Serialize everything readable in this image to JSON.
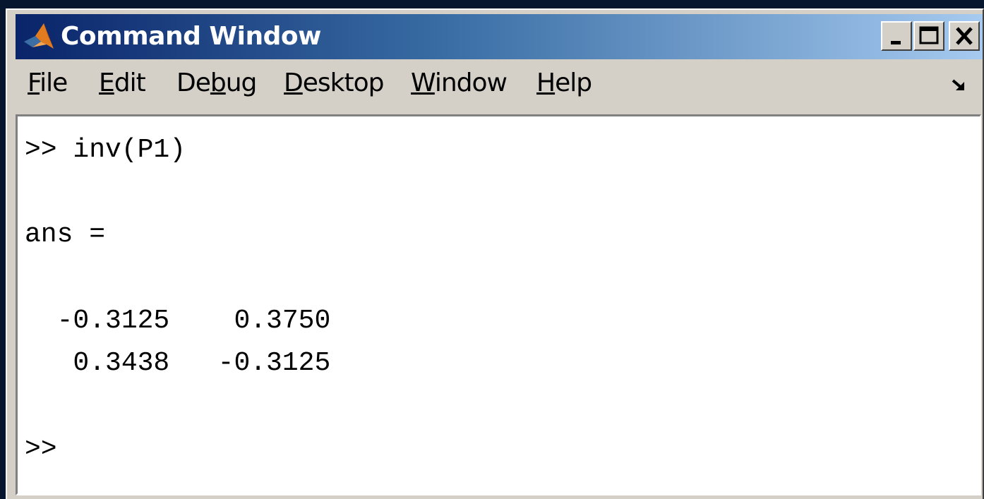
{
  "window": {
    "title": "Command Window",
    "controls": {
      "minimize": "minimize-icon",
      "maximize": "maximize-icon",
      "close": "close-icon"
    }
  },
  "menu": {
    "items": [
      {
        "label_pre": "",
        "label_ul": "F",
        "label_post": "ile"
      },
      {
        "label_pre": "",
        "label_ul": "E",
        "label_post": "dit"
      },
      {
        "label_pre": "De",
        "label_ul": "b",
        "label_post": "ug"
      },
      {
        "label_pre": "",
        "label_ul": "D",
        "label_post": "esktop"
      },
      {
        "label_pre": "",
        "label_ul": "W",
        "label_post": "indow"
      },
      {
        "label_pre": "",
        "label_ul": "H",
        "label_post": "elp"
      }
    ],
    "undock_icon": "undock-arrow-icon"
  },
  "console": {
    "lines": [
      ">> inv(P1)",
      "ans =",
      "  -0.3125    0.3750",
      "   0.3438   -0.3125",
      ">>"
    ]
  },
  "colors": {
    "title_start": "#0a246a",
    "title_end": "#a6caf0",
    "chrome": "#d4d0c8",
    "background": "#06162e"
  }
}
